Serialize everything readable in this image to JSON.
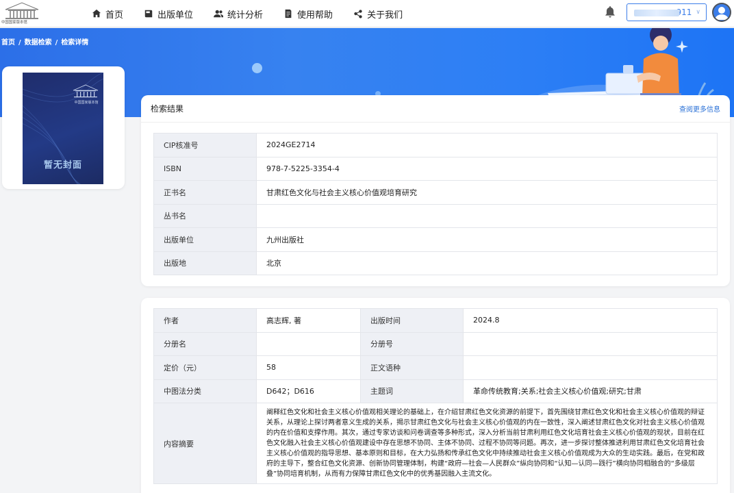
{
  "logo": {
    "text": "中国国家版本馆"
  },
  "nav": [
    {
      "label": "首页",
      "icon": "home-icon"
    },
    {
      "label": "出版单位",
      "icon": "book-icon"
    },
    {
      "label": "统计分析",
      "icon": "users-icon"
    },
    {
      "label": "使用帮助",
      "icon": "doc-icon"
    },
    {
      "label": "关于我们",
      "icon": "share-icon"
    }
  ],
  "user": {
    "suffix": "911"
  },
  "breadcrumb": [
    "首页",
    "数据检索",
    "检索详情"
  ],
  "cover": {
    "title": "暂无封面",
    "logo_text": "中国国家版本馆"
  },
  "card1": {
    "title": "检索结果",
    "more": "查阅更多信息",
    "rows": [
      {
        "label": "CIP核准号",
        "value": "2024GE2714"
      },
      {
        "label": "ISBN",
        "value": "978-7-5225-3354-4"
      },
      {
        "label": "正书名",
        "value": "甘肃红色文化与社会主义核心价值观培育研究"
      },
      {
        "label": "丛书名",
        "value": ""
      },
      {
        "label": "出版单位",
        "value": "九州出版社"
      },
      {
        "label": "出版地",
        "value": "北京"
      }
    ]
  },
  "card2": {
    "rows": [
      {
        "l1": "作者",
        "v1": "高志辉, 著",
        "l2": "出版时间",
        "v2": "2024.8"
      },
      {
        "l1": "分册名",
        "v1": "",
        "l2": "分册号",
        "v2": ""
      },
      {
        "l1": "定价（元）",
        "v1": "58",
        "l2": "正文语种",
        "v2": ""
      },
      {
        "l1": "中图法分类",
        "v1": "D642；D616",
        "l2": "主题词",
        "v2": "革命传统教育;关系;社会主义核心价值观;研究;甘肃"
      }
    ],
    "abstract_label": "内容摘要",
    "abstract": "阐释红色文化和社会主义核心价值观相关理论的基础上，在介绍甘肃红色文化资源的前提下，首先围绕甘肃红色文化和社会主义核心价值观的辩证关系，从理论上探讨两者意义生成的关系，揭示甘肃红色文化与社会主义核心价值观的内在一致性，深入阐述甘肃红色文化对社会主义核心价值观的内在价值和支撑作用。其次，通过专家访谈和问卷调查等多种形式，深入分析当前甘肃利用红色文化培育社会主义核心价值观的现状，目前在红色文化融入社会主义核心价值观建设中存在思想不协同、主体不协同、过程不协同等问题。再次，进一步探讨整体推进利用甘肃红色文化培育社会主义核心价值观的指导思想、基本原则和目标，在大力弘扬和传承红色文化中持续推动社会主义核心价值观成为大众的生动实践。最后，在党和政府的主导下，整合红色文化资源、创新协同管理体制，构建“政府—社会—人民群众”纵向协同和“认知—认同—践行”横向协同相融合的“多级层叠”协同培育机制，从而有力保障甘肃红色文化中的优秀基因融入主流文化。"
  },
  "colors": {
    "brand": "#2c6fe8",
    "link": "#2a70d6",
    "label_bg": "#eef0f5"
  }
}
